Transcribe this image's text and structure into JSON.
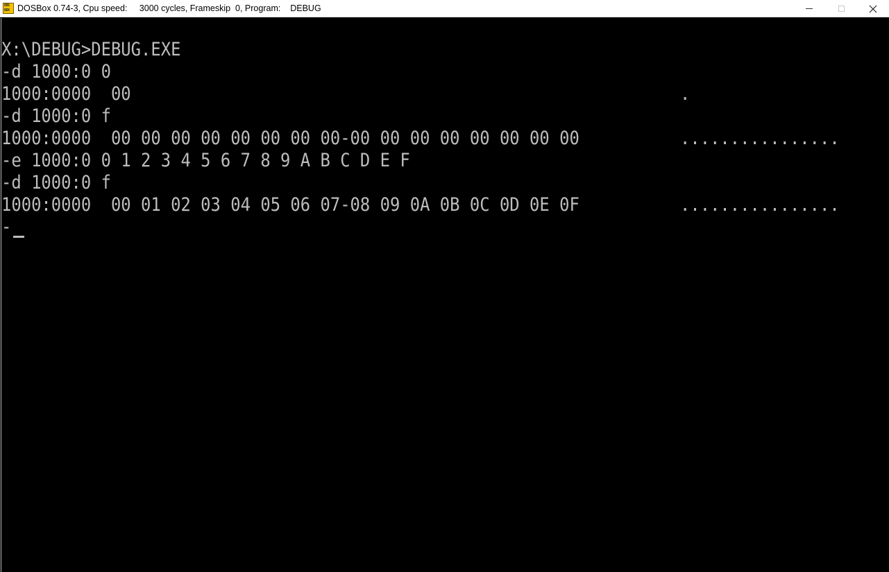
{
  "window": {
    "title": "DOSBox 0.74-3, Cpu speed:     3000 cycles, Frameskip  0, Program:    DEBUG",
    "icon": "dosbox-icon",
    "icon_text_top": "DOS",
    "icon_text_bottom": "BOX",
    "controls": {
      "minimize": "minimize-icon",
      "maximize": "maximize-icon",
      "close": "close-icon"
    }
  },
  "console": {
    "colors": {
      "background": "#000000",
      "foreground": "#bdbdbd"
    },
    "lines": [
      "X:\\DEBUG>DEBUG.EXE",
      "-d 1000:0 0",
      "1000:0000  00",
      "-d 1000:0 f",
      "1000:0000  00 00 00 00 00 00 00 00-00 00 00 00 00 00 00 00",
      "-e 1000:0 0 1 2 3 4 5 6 7 8 9 A B C D E F",
      "-d 1000:0 f",
      "1000:0000  00 01 02 03 04 05 06 07-08 09 0A 0B 0C 0D 0E 0F"
    ],
    "ascii_columns": [
      ".",
      "................",
      "................"
    ],
    "prompt": "-",
    "cursor": "_"
  }
}
